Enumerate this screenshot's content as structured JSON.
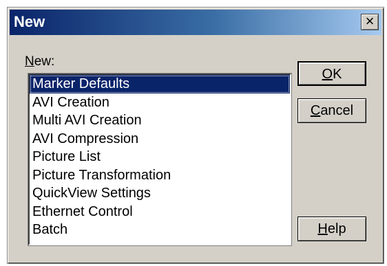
{
  "window": {
    "title": "New",
    "close_glyph": "×"
  },
  "list": {
    "caption_mnemonic": "N",
    "caption_rest": "ew:",
    "items": [
      "Marker Defaults",
      "AVI Creation",
      "Multi AVI Creation",
      "AVI Compression",
      "Picture List",
      "Picture Transformation",
      "QuickView Settings",
      "Ethernet Control",
      "Batch"
    ],
    "selected_index": 0
  },
  "buttons": {
    "ok": {
      "mnemonic": "O",
      "rest": "K"
    },
    "cancel": {
      "mnemonic": "C",
      "rest": "ancel"
    },
    "help": {
      "mnemonic": "H",
      "rest": "elp"
    }
  },
  "colors": {
    "title_start": "#0a246a",
    "title_end": "#a6caf0",
    "face": "#d4d0c8",
    "selection": "#0a246a"
  }
}
